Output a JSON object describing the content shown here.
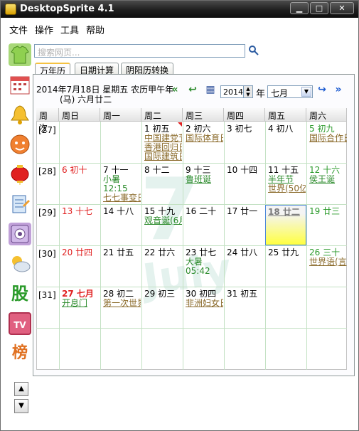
{
  "app": {
    "title": "DesktopSprite 4.1"
  },
  "menu": [
    "文件",
    "操作",
    "工具",
    "帮助"
  ],
  "search": {
    "placeholder": "搜索网页..."
  },
  "tabs": [
    "万年历",
    "日期计算",
    "阴阳历转换"
  ],
  "header": {
    "line1": "2014年7月18日 星期五 农历甲午年",
    "line2": "(马) 六月廿二",
    "year": "2014",
    "year_unit": "年",
    "month": "七月"
  },
  "grid": {
    "columns": [
      "周次",
      "周日",
      "周一",
      "周二",
      "周三",
      "周四",
      "周五",
      "周六"
    ],
    "weeks": [
      "[27]",
      "[28]",
      "[29]",
      "[30]",
      "[31]"
    ],
    "cells": [
      {
        "date": "1 初五",
        "lines": [
          "中国建党节",
          "香港回归日",
          "国际建筑日"
        ]
      },
      {
        "date": "2 初六",
        "lines": [
          "国际体育日"
        ]
      },
      {
        "date": "3 初七",
        "lines": []
      },
      {
        "date": "4 初八",
        "lines": []
      },
      {
        "date": "5 初九",
        "lines": [
          "国际合作日"
        ]
      },
      {
        "date": "6 初十",
        "lines": []
      },
      {
        "date": "7 十一",
        "lines": [
          "小暑",
          "12:15",
          "七七事变日"
        ]
      },
      {
        "date": "8 十二",
        "lines": []
      },
      {
        "date": "9 十三",
        "lines": [
          "鲁班诞"
        ]
      },
      {
        "date": "10 十四",
        "lines": []
      },
      {
        "date": "11 十五",
        "lines": [
          "半年节",
          "世界(50亿)"
        ]
      },
      {
        "date": "12 十六",
        "lines": [
          "侯王诞"
        ]
      },
      {
        "date": "13 十七",
        "lines": []
      },
      {
        "date": "14 十八",
        "lines": []
      },
      {
        "date": "15 十九",
        "lines": [
          "观音诞(6月)"
        ]
      },
      {
        "date": "16 二十",
        "lines": []
      },
      {
        "date": "17 廿一",
        "lines": []
      },
      {
        "date": "18 廿二",
        "lines": []
      },
      {
        "date": "19 廿三",
        "lines": []
      },
      {
        "date": "20 廿四",
        "lines": []
      },
      {
        "date": "21 廿五",
        "lines": []
      },
      {
        "date": "22 廿六",
        "lines": []
      },
      {
        "date": "23 廿七",
        "lines": [
          "大暑",
          "05:42"
        ]
      },
      {
        "date": "24 廿八",
        "lines": []
      },
      {
        "date": "25 廿九",
        "lines": []
      },
      {
        "date": "26 三十",
        "lines": [
          "世界语(言)"
        ]
      },
      {
        "date": "27 七月",
        "lines": [
          "开息门"
        ]
      },
      {
        "date": "28 初二",
        "lines": [
          "第一次世界"
        ]
      },
      {
        "date": "29 初三",
        "lines": []
      },
      {
        "date": "30 初四",
        "lines": [
          "非洲妇女日"
        ]
      },
      {
        "date": "31 初五",
        "lines": []
      }
    ]
  },
  "watermark": "7",
  "watermark_word": "July",
  "colors": {
    "today_fill": "#ffff40",
    "holiday_red": "#e02020",
    "festival_green": "#2a8a2a",
    "note_brown": "#8a6a2a"
  },
  "sidebar_icons": [
    "shirt-icon",
    "calendar-icon",
    "bell-icon",
    "face-icon",
    "lantern-icon",
    "notepad-icon",
    "phone-icon",
    "weather-icon",
    "stock-icon",
    "tv-icon",
    "ranking-icon"
  ],
  "sidebar_glyphs": {
    "stock": "股",
    "tv": "TV",
    "ranking": "榜"
  },
  "scroll": {
    "up": "▲",
    "down": "▼"
  }
}
